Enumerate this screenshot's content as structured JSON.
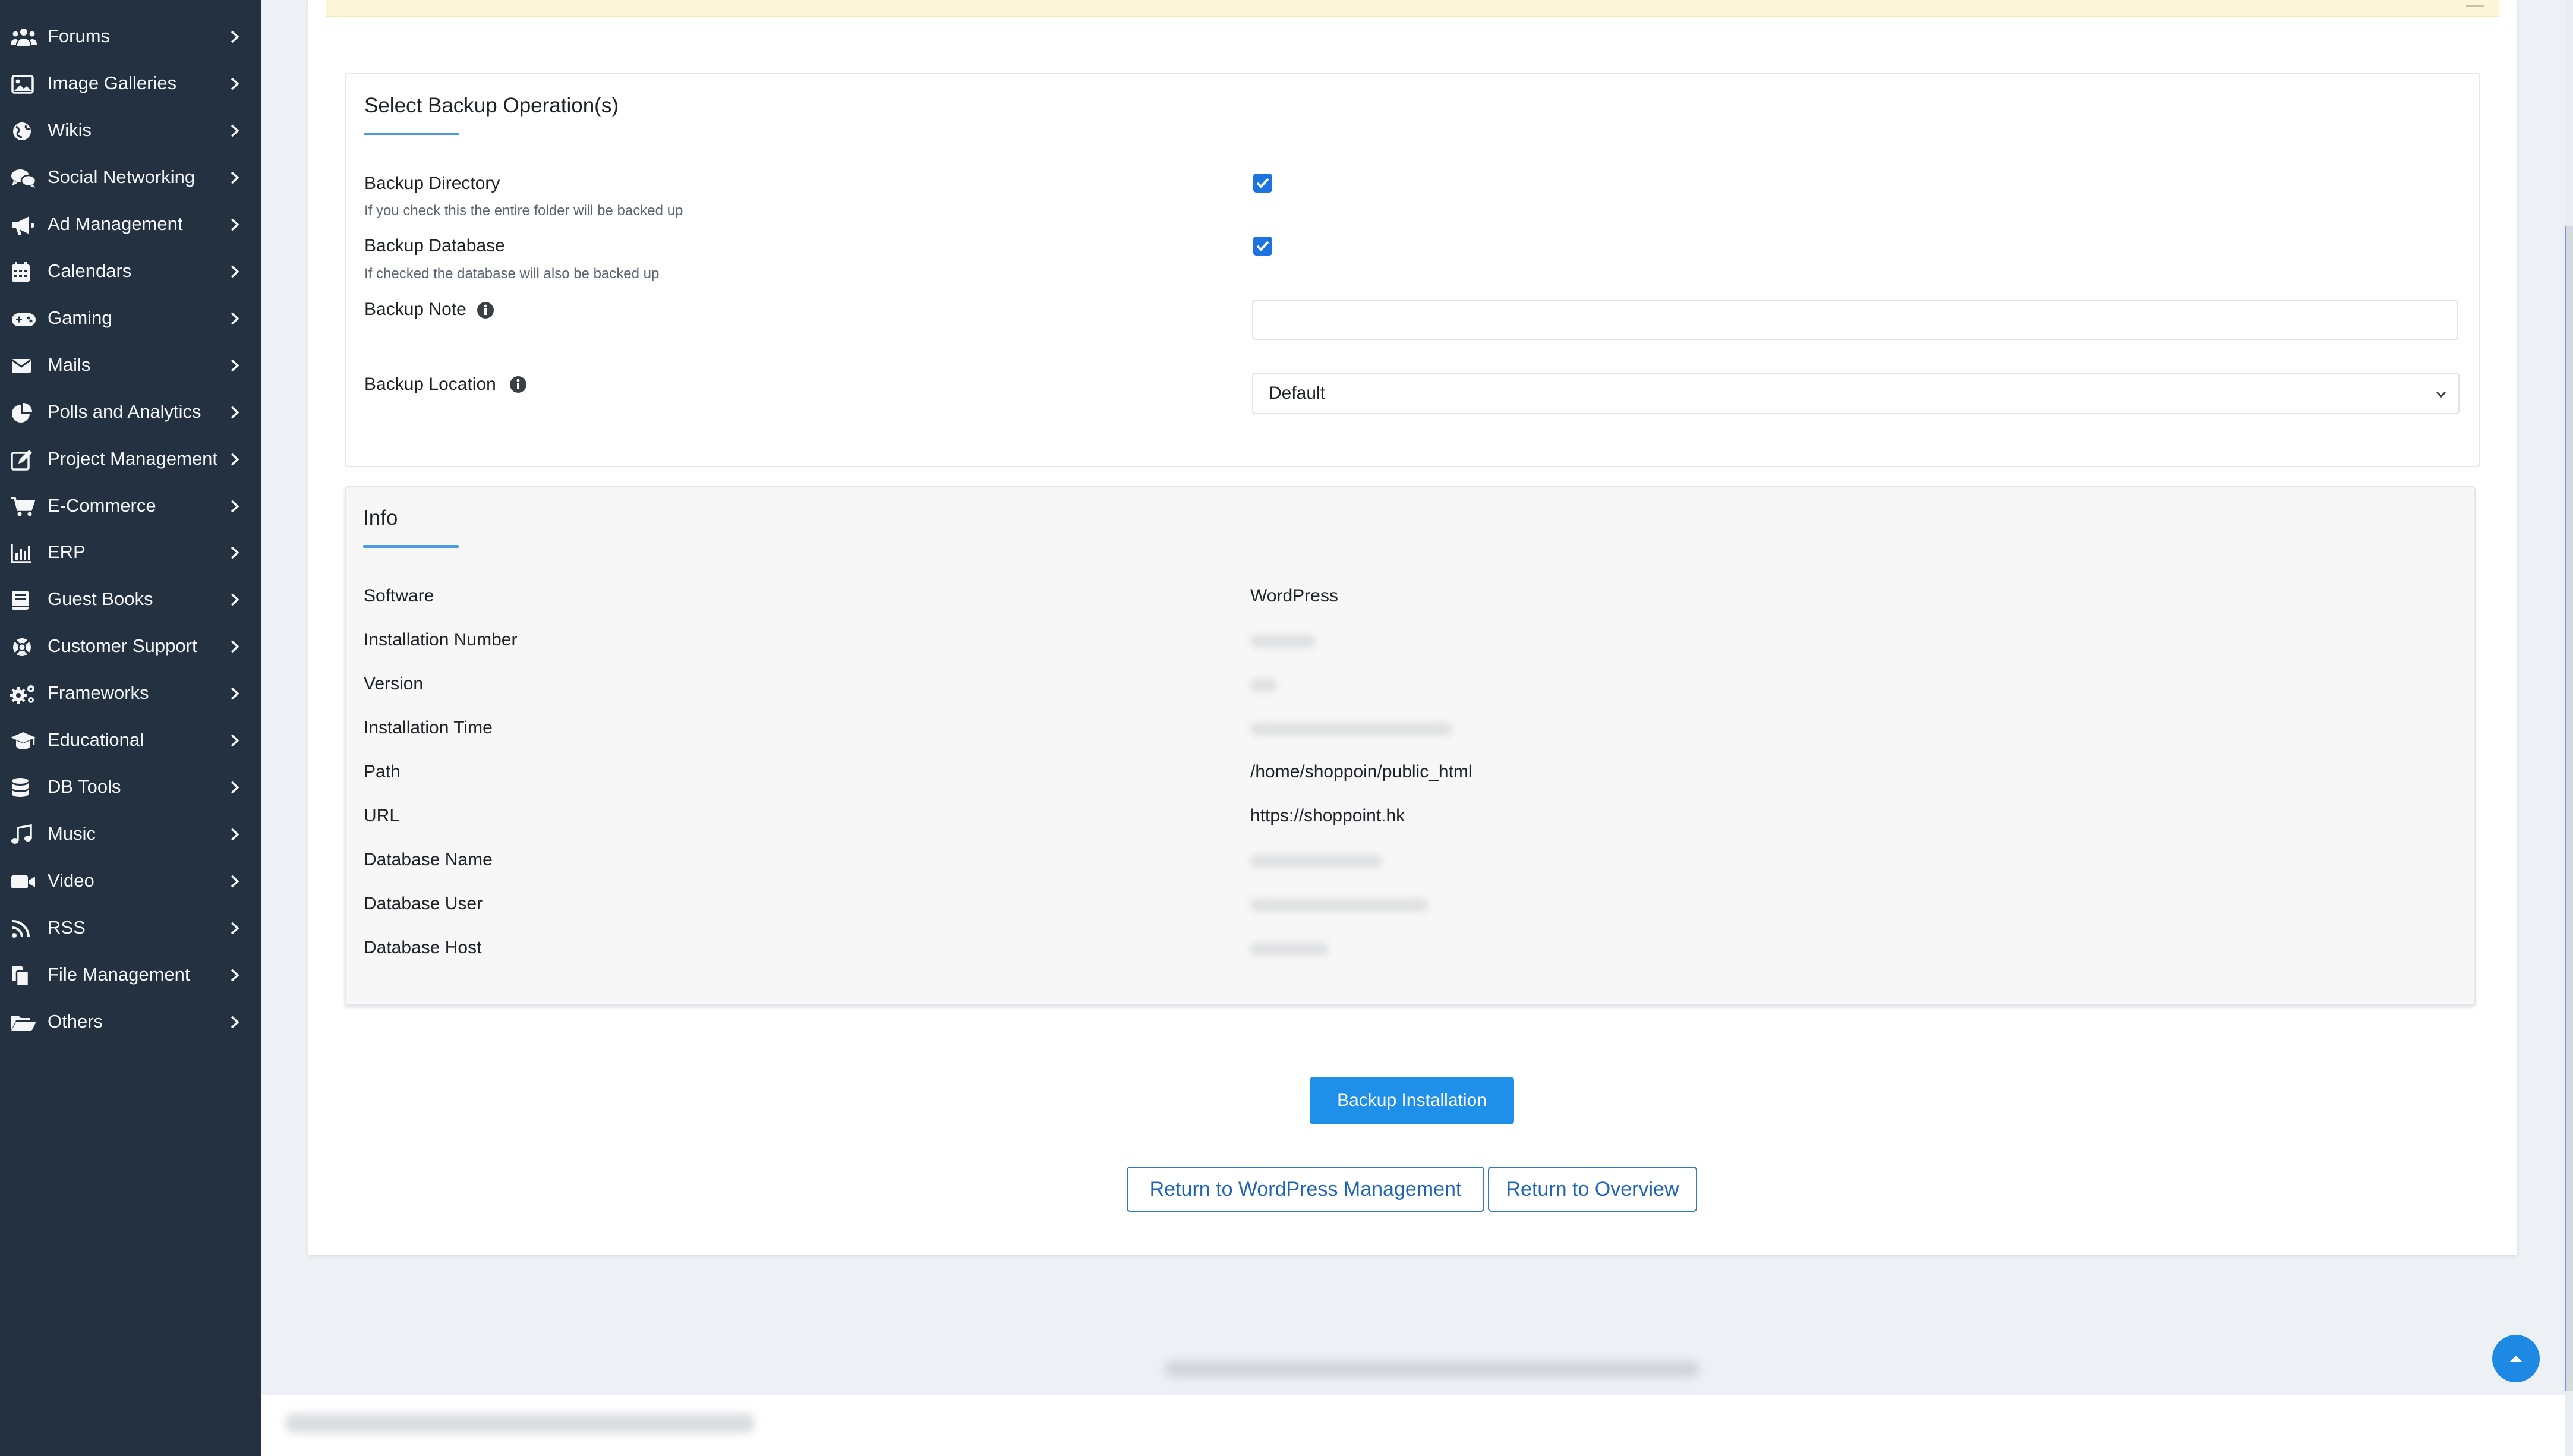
{
  "sidebar": {
    "items": [
      {
        "label": "Forums",
        "icon": "users-icon"
      },
      {
        "label": "Image Galleries",
        "icon": "image-icon"
      },
      {
        "label": "Wikis",
        "icon": "globe-icon"
      },
      {
        "label": "Social Networking",
        "icon": "comments-icon"
      },
      {
        "label": "Ad Management",
        "icon": "bullhorn-icon"
      },
      {
        "label": "Calendars",
        "icon": "calendar-icon"
      },
      {
        "label": "Gaming",
        "icon": "gamepad-icon"
      },
      {
        "label": "Mails",
        "icon": "envelope-icon"
      },
      {
        "label": "Polls and Analytics",
        "icon": "chart-pie-icon"
      },
      {
        "label": "Project Management",
        "icon": "edit-icon"
      },
      {
        "label": "E-Commerce",
        "icon": "cart-icon"
      },
      {
        "label": "ERP",
        "icon": "bar-chart-icon"
      },
      {
        "label": "Guest Books",
        "icon": "book-icon"
      },
      {
        "label": "Customer Support",
        "icon": "life-ring-icon"
      },
      {
        "label": "Frameworks",
        "icon": "cogs-icon"
      },
      {
        "label": "Educational",
        "icon": "graduation-cap-icon"
      },
      {
        "label": "DB Tools",
        "icon": "database-icon"
      },
      {
        "label": "Music",
        "icon": "music-icon"
      },
      {
        "label": "Video",
        "icon": "video-icon"
      },
      {
        "label": "RSS",
        "icon": "rss-icon"
      },
      {
        "label": "File Management",
        "icon": "files-icon"
      },
      {
        "label": "Others",
        "icon": "folder-open-icon"
      }
    ]
  },
  "backup_form": {
    "title": "Select Backup Operation(s)",
    "directory": {
      "label": "Backup Directory",
      "help": "If you check this the entire folder will be backed up",
      "checked": true
    },
    "database": {
      "label": "Backup Database",
      "help": "If checked the database will also be backed up",
      "checked": true
    },
    "note": {
      "label": "Backup Note",
      "value": ""
    },
    "location": {
      "label": "Backup Location",
      "value": "Default"
    }
  },
  "info": {
    "title": "Info",
    "rows": [
      {
        "label": "Software",
        "value": "WordPress"
      },
      {
        "label": "Installation Number",
        "value": null
      },
      {
        "label": "Version",
        "value": null
      },
      {
        "label": "Installation Time",
        "value": null
      },
      {
        "label": "Path",
        "value": "/home/shoppoin/public_html"
      },
      {
        "label": "URL",
        "value": "https://shoppoint.hk"
      },
      {
        "label": "Database Name",
        "value": null
      },
      {
        "label": "Database User",
        "value": null
      },
      {
        "label": "Database Host",
        "value": null
      }
    ]
  },
  "actions": {
    "backup": "Backup Installation",
    "return_wp": "Return to WordPress Management",
    "return_overview": "Return to Overview"
  },
  "colors": {
    "sidebar_bg": "#233140",
    "accent": "#1e90ea",
    "checkbox": "#1d74e0",
    "banner": "#fdf6d8"
  }
}
